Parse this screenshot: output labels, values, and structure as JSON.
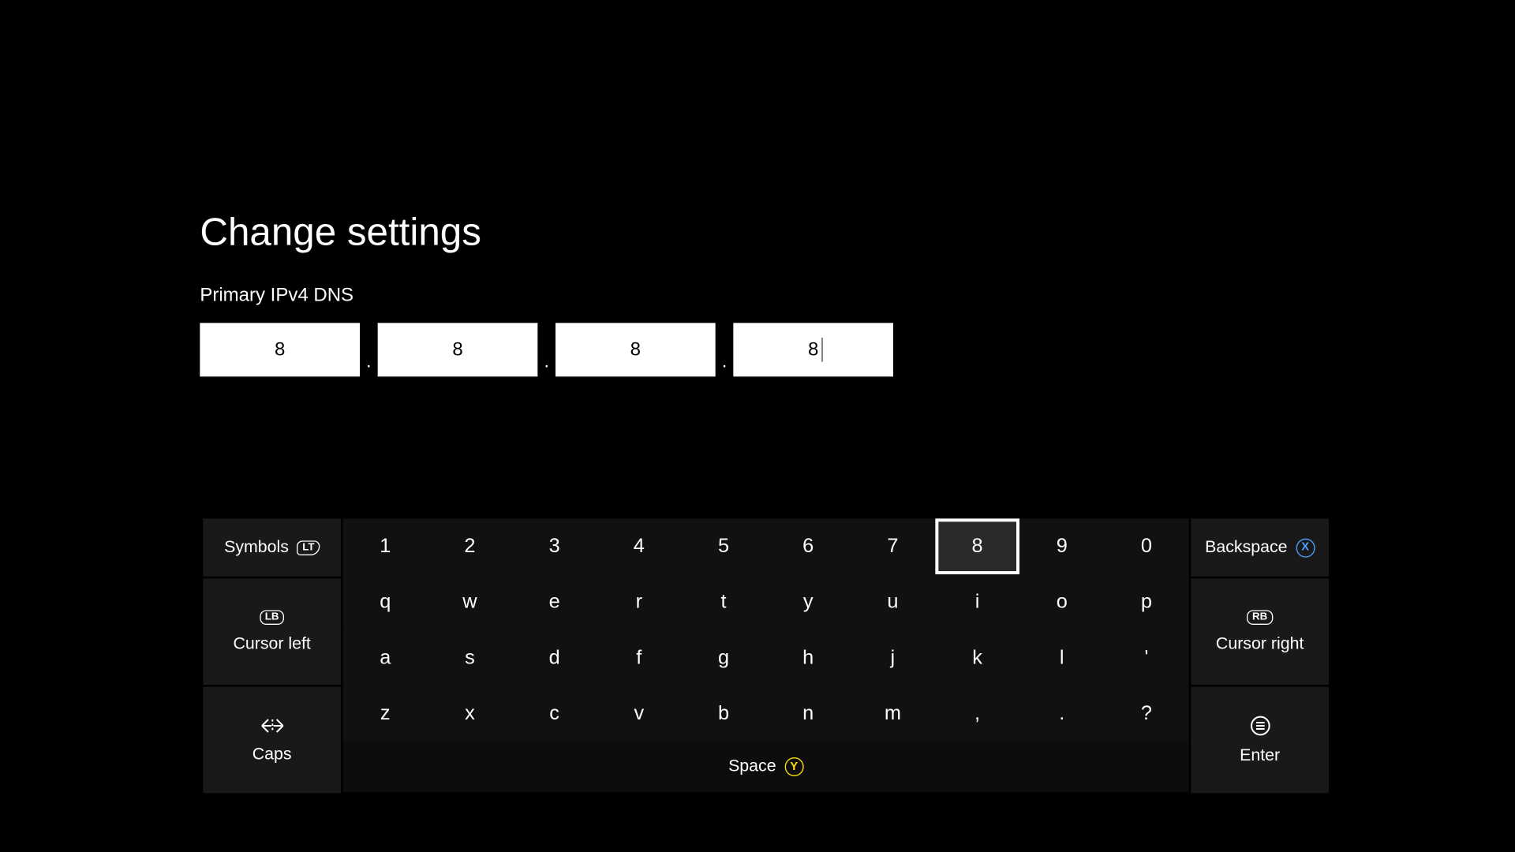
{
  "title": "Change settings",
  "field_label": "Primary IPv4 DNS",
  "ip": {
    "o1": "8",
    "o2": "8",
    "o3": "8",
    "o4": "8"
  },
  "dot": ".",
  "keys": {
    "row0": [
      "1",
      "2",
      "3",
      "4",
      "5",
      "6",
      "7",
      "8",
      "9",
      "0"
    ],
    "row1": [
      "q",
      "w",
      "e",
      "r",
      "t",
      "y",
      "u",
      "i",
      "o",
      "p"
    ],
    "row2": [
      "a",
      "s",
      "d",
      "f",
      "g",
      "h",
      "j",
      "k",
      "l",
      "'"
    ],
    "row3": [
      "z",
      "x",
      "c",
      "v",
      "b",
      "n",
      "m",
      ",",
      ".",
      "?"
    ]
  },
  "selected_key": "8",
  "side": {
    "symbols": "Symbols",
    "cursor_left": "Cursor left",
    "caps": "Caps",
    "backspace": "Backspace",
    "cursor_right": "Cursor right",
    "enter": "Enter",
    "space": "Space"
  },
  "glyph": {
    "lt": "LT",
    "lb": "LB",
    "rb": "RB",
    "x": "X",
    "y": "Y"
  }
}
